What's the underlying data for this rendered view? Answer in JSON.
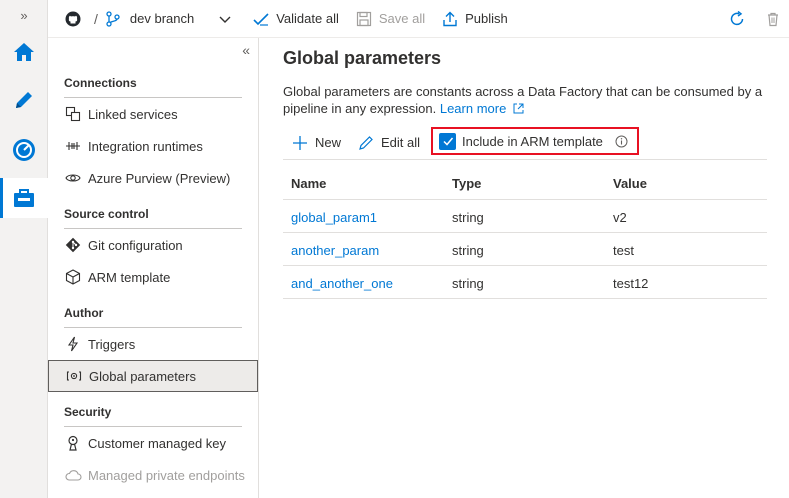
{
  "toolbar": {
    "branch": "dev branch",
    "validate_all": "Validate all",
    "save_all": "Save all",
    "publish": "Publish"
  },
  "nav": {
    "sections": {
      "connections": "Connections",
      "source_control": "Source control",
      "author": "Author",
      "security": "Security"
    },
    "items": {
      "linked_services": "Linked services",
      "integration_runtimes": "Integration runtimes",
      "azure_purview": "Azure Purview (Preview)",
      "git_configuration": "Git configuration",
      "arm_template": "ARM template",
      "triggers": "Triggers",
      "global_parameters": "Global parameters",
      "customer_managed_key": "Customer managed key",
      "managed_private_endpoints": "Managed private endpoints"
    }
  },
  "main": {
    "title": "Global parameters",
    "description": "Global parameters are constants across a Data Factory that can be consumed by a pipeline in any expression.",
    "learn_more": "Learn more",
    "commands": {
      "new": "New",
      "edit_all": "Edit all",
      "include_arm": "Include in ARM template"
    },
    "include_arm_checked": true,
    "columns": [
      "Name",
      "Type",
      "Value"
    ],
    "rows": [
      {
        "name": "global_param1",
        "type": "string",
        "value": "v2"
      },
      {
        "name": "another_param",
        "type": "string",
        "value": "test"
      },
      {
        "name": "and_another_one",
        "type": "string",
        "value": "test12"
      }
    ]
  },
  "colors": {
    "accent": "#0078d4",
    "highlight_border": "#e81123"
  }
}
